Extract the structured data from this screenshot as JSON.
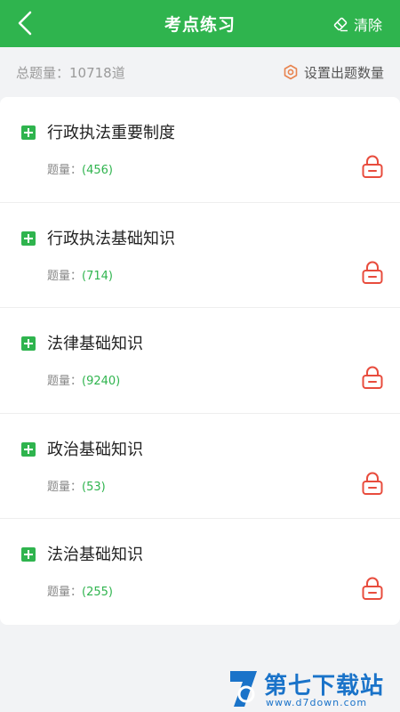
{
  "header": {
    "title": "考点练习",
    "clear_label": "清除"
  },
  "summary": {
    "total_text": "总题量：10718道",
    "settings_label": "设置出题数量"
  },
  "items": [
    {
      "title": "行政执法重要制度",
      "count_label": "题量：",
      "count_value": "(456)"
    },
    {
      "title": "行政执法基础知识",
      "count_label": "题量：",
      "count_value": "(714)"
    },
    {
      "title": "法律基础知识",
      "count_label": "题量：",
      "count_value": "(9240)"
    },
    {
      "title": "政治基础知识",
      "count_label": "题量：",
      "count_value": "(53)"
    },
    {
      "title": "法治基础知识",
      "count_label": "题量：",
      "count_value": "(255)"
    }
  ],
  "watermark": {
    "brand": "第七下载站",
    "url": "www.d7down.com"
  },
  "colors": {
    "primary": "#2fb44e",
    "lock": "#e84c3d",
    "watermark": "#1a73c9"
  },
  "icons": [
    "back-arrow-icon",
    "eraser-icon",
    "gear-icon",
    "plus-square-icon",
    "lock-icon"
  ]
}
